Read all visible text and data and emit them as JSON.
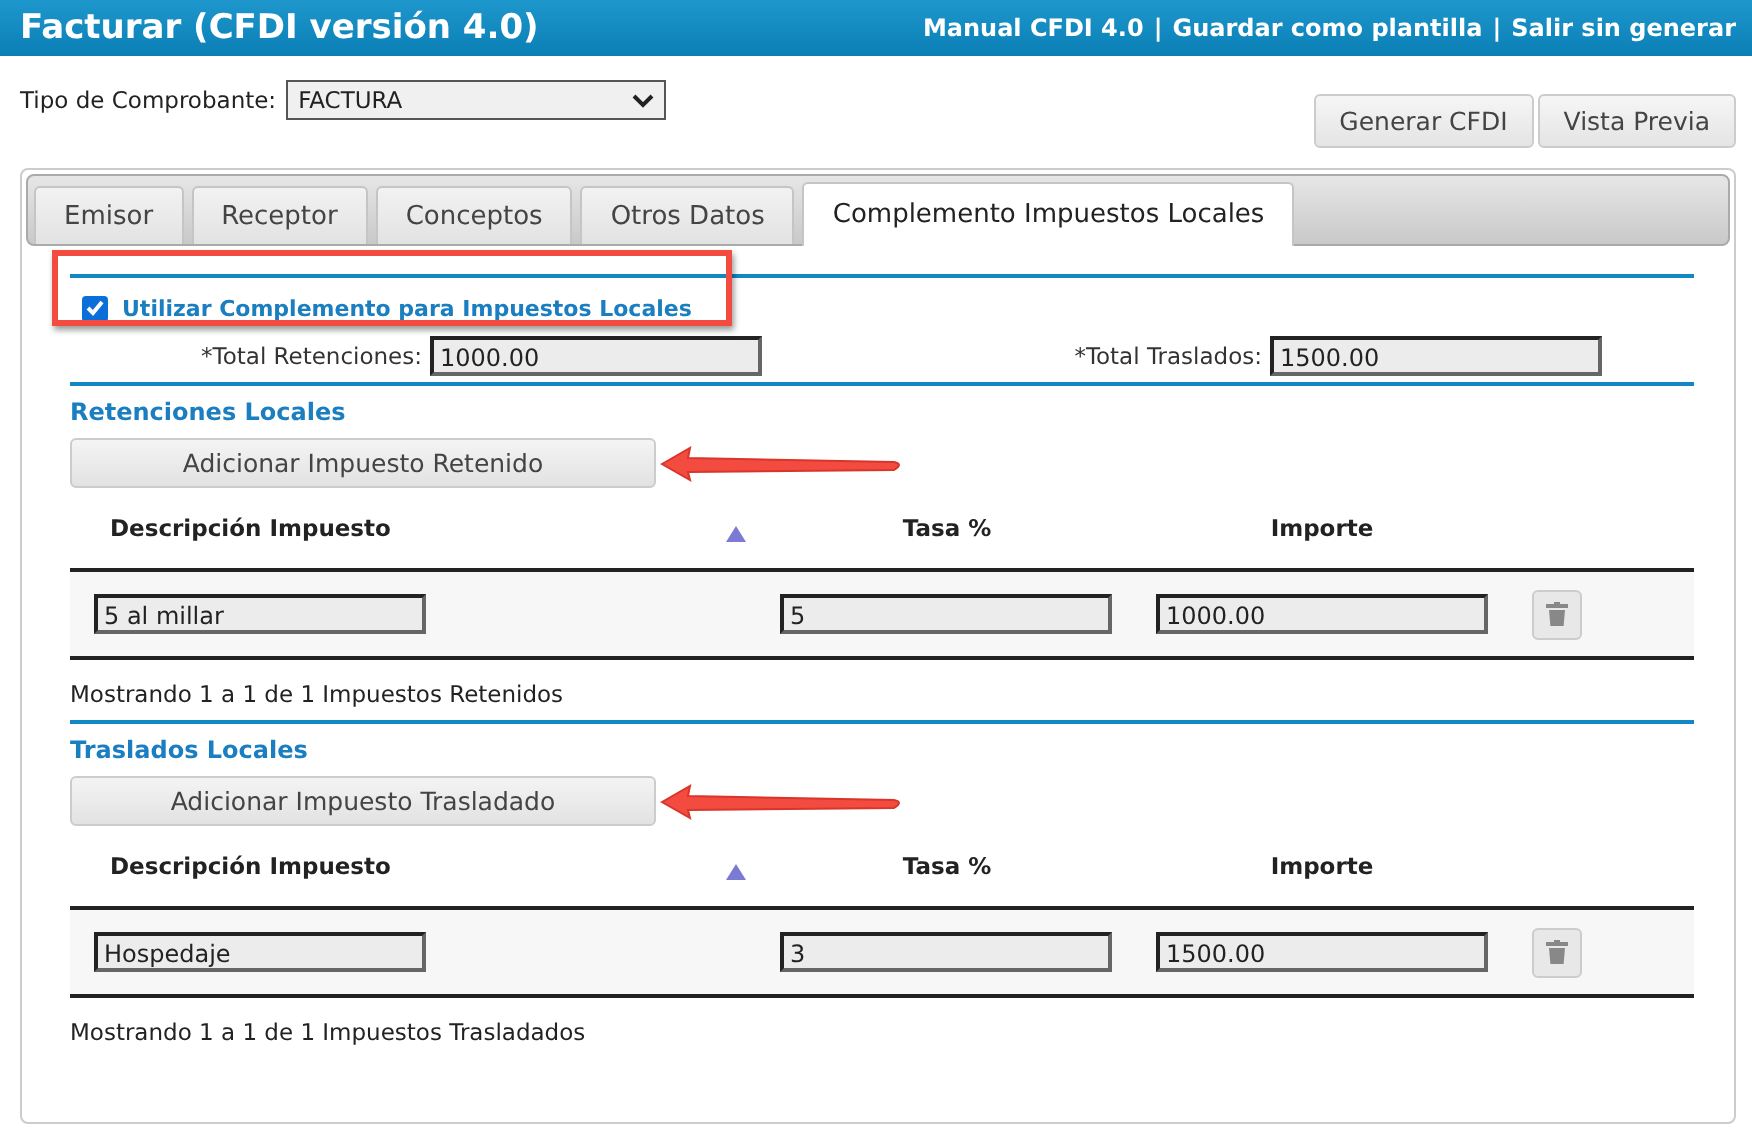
{
  "header": {
    "title": "Facturar (CFDI versión 4.0)",
    "links": [
      "Manual CFDI 4.0",
      "Guardar como plantilla",
      "Salir sin generar"
    ],
    "separator": "|"
  },
  "comprobante": {
    "label": "Tipo de Comprobante:",
    "value": "FACTURA"
  },
  "actions": [
    "Generar CFDI",
    "Vista Previa"
  ],
  "tabs": [
    {
      "label": "Emisor",
      "selected": false
    },
    {
      "label": "Receptor",
      "selected": false
    },
    {
      "label": "Conceptos",
      "selected": false
    },
    {
      "label": "Otros Datos",
      "selected": false
    },
    {
      "label": "Complemento Impuestos Locales",
      "selected": true
    }
  ],
  "complemento": {
    "label": "Utilizar Complemento para Impuestos Locales",
    "checked": true,
    "highlighted": true
  },
  "totals": [
    {
      "label": "*Total Retenciones:",
      "value": "1000.00"
    },
    {
      "label": "*Total Traslados:",
      "value": "1500.00"
    }
  ],
  "sections": [
    {
      "title": "Retenciones Locales",
      "add_button": "Adicionar Impuesto Retenido",
      "arrow": true,
      "columns": [
        "Descripción Impuesto",
        "Tasa %",
        "Importe"
      ],
      "rows": [
        {
          "descripcion": "5 al millar",
          "tasa": "5",
          "importe": "1000.00"
        }
      ],
      "footer": "Mostrando 1 a 1 de 1 Impuestos Retenidos"
    },
    {
      "title": "Traslados Locales",
      "add_button": "Adicionar Impuesto Trasladado",
      "arrow": true,
      "columns": [
        "Descripción Impuesto",
        "Tasa %",
        "Importe"
      ],
      "rows": [
        {
          "descripcion": "Hospedaje",
          "tasa": "3",
          "importe": "1500.00"
        }
      ],
      "footer": "Mostrando 1 a 1 de 1 Impuestos Trasladados"
    }
  ]
}
